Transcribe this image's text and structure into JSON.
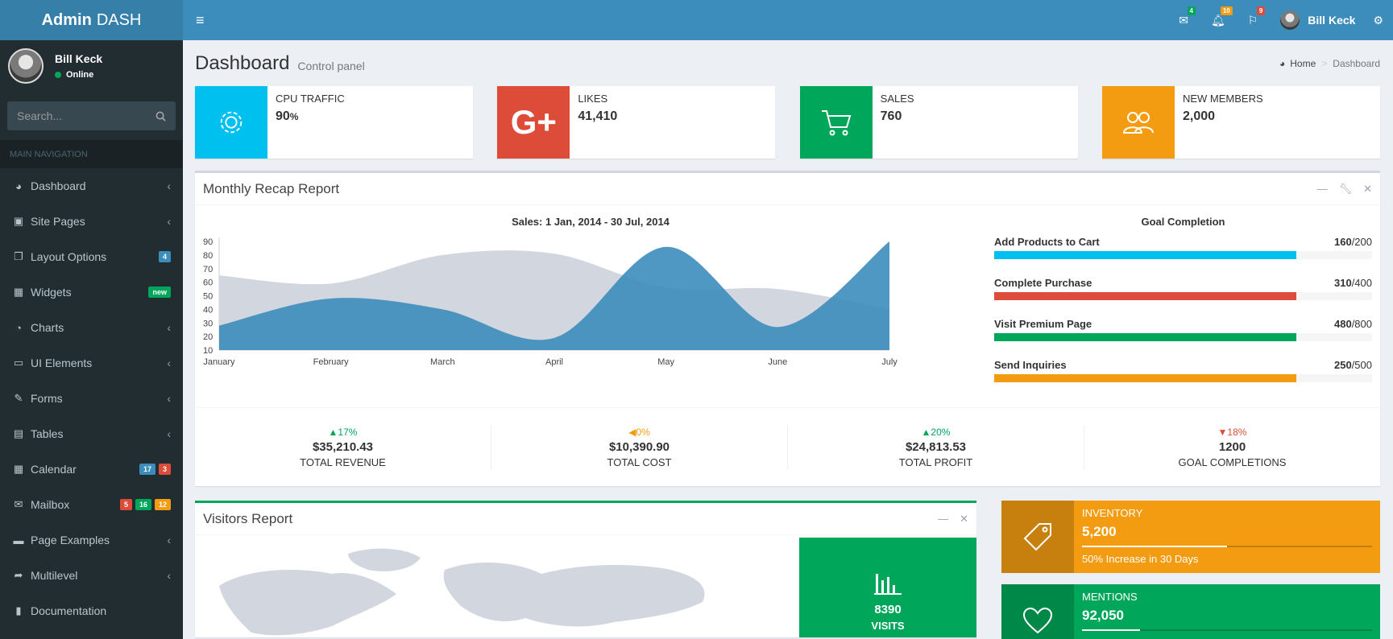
{
  "sidebar": {
    "logo_bold": "Admin",
    "logo_rest": "DASH",
    "user": {
      "name": "Bill Keck",
      "status": "Online"
    },
    "search": {
      "placeholder": "Search..."
    },
    "nav_header": "MAIN NAVIGATION",
    "items": [
      {
        "label": "Dashboard",
        "icon": "dashboard-icon"
      },
      {
        "label": "Site Pages",
        "icon": "pages-icon"
      },
      {
        "label": "Layout Options",
        "icon": "layout-icon",
        "badges": [
          "4"
        ]
      },
      {
        "label": "Widgets",
        "icon": "widgets-icon",
        "badges": [
          "new"
        ]
      },
      {
        "label": "Charts",
        "icon": "pie-chart-icon"
      },
      {
        "label": "UI Elements",
        "icon": "laptop-icon"
      },
      {
        "label": "Forms",
        "icon": "edit-icon"
      },
      {
        "label": "Tables",
        "icon": "table-icon"
      },
      {
        "label": "Calendar",
        "icon": "calendar-icon",
        "badges": [
          "17",
          "3"
        ]
      },
      {
        "label": "Mailbox",
        "icon": "envelope-icon",
        "badges": [
          "5",
          "16",
          "12"
        ]
      },
      {
        "label": "Page Examples",
        "icon": "folder-icon"
      },
      {
        "label": "Multilevel",
        "icon": "share-icon"
      },
      {
        "label": "Documentation",
        "icon": "book-icon"
      }
    ]
  },
  "topbar": {
    "mail_count": "4",
    "notif_count": "10",
    "flag_count": "9",
    "user_name": "Bill Keck"
  },
  "header": {
    "title": "Dashboard",
    "subtitle": "Control panel",
    "breadcrumb_home": "Home",
    "breadcrumb_current": "Dashboard"
  },
  "info_boxes": [
    {
      "label": "CPU TRAFFIC",
      "value": "90",
      "unit": "%",
      "color": "#00c0ef",
      "icon": "gear-icon"
    },
    {
      "label": "LIKES",
      "value": "41,410",
      "unit": "",
      "color": "#dd4b39",
      "icon": "google-plus-icon"
    },
    {
      "label": "SALES",
      "value": "760",
      "unit": "",
      "color": "#00a65a",
      "icon": "cart-icon"
    },
    {
      "label": "NEW MEMBERS",
      "value": "2,000",
      "unit": "",
      "color": "#f39c12",
      "icon": "users-icon"
    }
  ],
  "recap": {
    "title": "Monthly Recap Report",
    "goal_title": "Goal Completion",
    "goals": [
      {
        "label": "Add Products to Cart",
        "value": "160",
        "total": "/200",
        "color": "#00c0ef",
        "fraction": 0.8
      },
      {
        "label": "Complete Purchase",
        "value": "310",
        "total": "/400",
        "color": "#dd4b39",
        "fraction": 0.8
      },
      {
        "label": "Visit Premium Page",
        "value": "480",
        "total": "/800",
        "color": "#00a65a",
        "fraction": 0.8
      },
      {
        "label": "Send Inquiries",
        "value": "250",
        "total": "/500",
        "color": "#f39c12",
        "fraction": 0.8
      }
    ],
    "stats": [
      {
        "pct": "17%",
        "arrow": "▲",
        "color": "#00a65a",
        "value": "$35,210.43",
        "label": "TOTAL REVENUE"
      },
      {
        "pct": "0%",
        "arrow": "◀",
        "color": "#f39c12",
        "value": "$10,390.90",
        "label": "TOTAL COST"
      },
      {
        "pct": "20%",
        "arrow": "▲",
        "color": "#00a65a",
        "value": "$24,813.53",
        "label": "TOTAL PROFIT"
      },
      {
        "pct": "18%",
        "arrow": "▼",
        "color": "#dd4b39",
        "value": "1200",
        "label": "GOAL COMPLETIONS"
      }
    ]
  },
  "chart_data": {
    "type": "area",
    "title": "Sales: 1 Jan, 2014 - 30 Jul, 2014",
    "categories": [
      "January",
      "February",
      "March",
      "April",
      "May",
      "June",
      "July"
    ],
    "yticks": [
      10,
      20,
      30,
      40,
      50,
      60,
      70,
      80,
      90
    ],
    "ylim": [
      10,
      90
    ],
    "series": [
      {
        "values": [
          65,
          59,
          80,
          81,
          56,
          55,
          40
        ],
        "color": "#d2d6de"
      },
      {
        "values": [
          28,
          48,
          40,
          19,
          86,
          27,
          90
        ],
        "color": "#3c8dbc"
      }
    ]
  },
  "visitors": {
    "title": "Visitors Report",
    "visits": "8390",
    "visits_label": "VISITS"
  },
  "tiles": [
    {
      "label": "INVENTORY",
      "value": "5,200",
      "desc": "50% Increase in 30 Days",
      "color": "#f39c12",
      "progress": 0.5,
      "icon": "tag-icon"
    },
    {
      "label": "MENTIONS",
      "value": "92,050",
      "desc": "",
      "color": "#00a65a",
      "progress": 0.2,
      "icon": "heart-icon"
    }
  ]
}
